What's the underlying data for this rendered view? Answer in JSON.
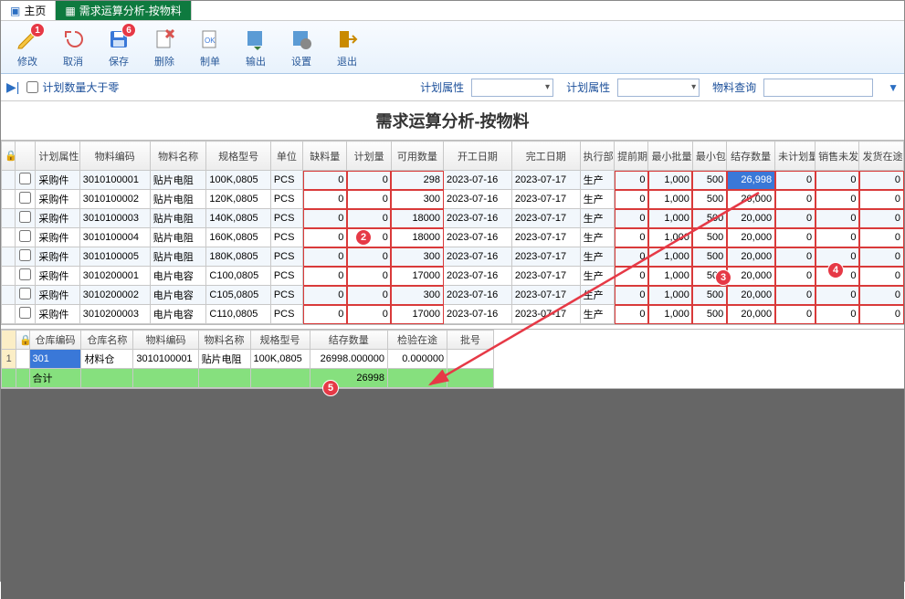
{
  "tabs": {
    "home": "主页",
    "current": "需求运算分析-按物料"
  },
  "toolbar": {
    "modify": "修改",
    "cancel": "取消",
    "save": "保存",
    "delete": "删除",
    "makeorder": "制单",
    "export": "输出",
    "settings": "设置",
    "exit": "退出",
    "badge_modify": "1",
    "badge_save": "6"
  },
  "filter": {
    "check_label": "计划数量大于零",
    "plan_attr1_label": "计划属性",
    "plan_attr2_label": "计划属性",
    "material_search_label": "物料查询"
  },
  "title": "需求运算分析-按物料",
  "headers": [
    "",
    "",
    "计划属性",
    "物料编码",
    "物料名称",
    "规格型号",
    "单位",
    "缺料量",
    "计划量",
    "可用数量",
    "开工日期",
    "完工日期",
    "执行部门",
    "提前期",
    "最小批量",
    "最小包装",
    "结存数量",
    "未计划量",
    "销售未发货量",
    "发货在途量"
  ],
  "rows": [
    {
      "pa": "采购件",
      "code": "3010100001",
      "name": "贴片电阻",
      "spec": "100K,0805",
      "uom": "PCS",
      "short": "0",
      "plan": "0",
      "avail": "298",
      "start": "2023-07-16",
      "end": "2023-07-17",
      "dept": "生产",
      "lead": "0",
      "minb": "1,000",
      "minp": "500",
      "stock": "26,998",
      "unplan": "0",
      "unsent": "0",
      "intransit": "0",
      "hlstock": true
    },
    {
      "pa": "采购件",
      "code": "3010100002",
      "name": "贴片电阻",
      "spec": "120K,0805",
      "uom": "PCS",
      "short": "0",
      "plan": "0",
      "avail": "300",
      "start": "2023-07-16",
      "end": "2023-07-17",
      "dept": "生产",
      "lead": "0",
      "minb": "1,000",
      "minp": "500",
      "stock": "20,000",
      "unplan": "0",
      "unsent": "0",
      "intransit": "0"
    },
    {
      "pa": "采购件",
      "code": "3010100003",
      "name": "贴片电阻",
      "spec": "140K,0805",
      "uom": "PCS",
      "short": "0",
      "plan": "0",
      "avail": "18000",
      "start": "2023-07-16",
      "end": "2023-07-17",
      "dept": "生产",
      "lead": "0",
      "minb": "1,000",
      "minp": "500",
      "stock": "20,000",
      "unplan": "0",
      "unsent": "0",
      "intransit": "0"
    },
    {
      "pa": "采购件",
      "code": "3010100004",
      "name": "贴片电阻",
      "spec": "160K,0805",
      "uom": "PCS",
      "short": "0",
      "plan": "0",
      "avail": "18000",
      "start": "2023-07-16",
      "end": "2023-07-17",
      "dept": "生产",
      "lead": "0",
      "minb": "1,000",
      "minp": "500",
      "stock": "20,000",
      "unplan": "0",
      "unsent": "0",
      "intransit": "0"
    },
    {
      "pa": "采购件",
      "code": "3010100005",
      "name": "贴片电阻",
      "spec": "180K,0805",
      "uom": "PCS",
      "short": "0",
      "plan": "0",
      "avail": "300",
      "start": "2023-07-16",
      "end": "2023-07-17",
      "dept": "生产",
      "lead": "0",
      "minb": "1,000",
      "minp": "500",
      "stock": "20,000",
      "unplan": "0",
      "unsent": "0",
      "intransit": "0"
    },
    {
      "pa": "采购件",
      "code": "3010200001",
      "name": "电片电容",
      "spec": "C100,0805",
      "uom": "PCS",
      "short": "0",
      "plan": "0",
      "avail": "17000",
      "start": "2023-07-16",
      "end": "2023-07-17",
      "dept": "生产",
      "lead": "0",
      "minb": "1,000",
      "minp": "500",
      "stock": "20,000",
      "unplan": "0",
      "unsent": "0",
      "intransit": "0"
    },
    {
      "pa": "采购件",
      "code": "3010200002",
      "name": "电片电容",
      "spec": "C105,0805",
      "uom": "PCS",
      "short": "0",
      "plan": "0",
      "avail": "300",
      "start": "2023-07-16",
      "end": "2023-07-17",
      "dept": "生产",
      "lead": "0",
      "minb": "1,000",
      "minp": "500",
      "stock": "20,000",
      "unplan": "0",
      "unsent": "0",
      "intransit": "0"
    },
    {
      "pa": "采购件",
      "code": "3010200003",
      "name": "电片电容",
      "spec": "C110,0805",
      "uom": "PCS",
      "short": "0",
      "plan": "0",
      "avail": "17000",
      "start": "2023-07-16",
      "end": "2023-07-17",
      "dept": "生产",
      "lead": "0",
      "minb": "1,000",
      "minp": "500",
      "stock": "20,000",
      "unplan": "0",
      "unsent": "0",
      "intransit": "0"
    }
  ],
  "headers2": [
    "",
    "",
    "仓库编码",
    "仓库名称",
    "物料编码",
    "物料名称",
    "规格型号",
    "结存数量",
    "检验在途",
    "批号"
  ],
  "rows2": [
    {
      "n": "1",
      "wc": "301",
      "wn": "材料仓",
      "mc": "3010100001",
      "mn": "贴片电阻",
      "spec": "100K,0805",
      "stock": "26998.000000",
      "insp": "0.000000",
      "lot": ""
    }
  ],
  "sum": {
    "label": "合计",
    "v": "26998"
  },
  "ann": {
    "a1": "1",
    "a2": "2",
    "a3": "3",
    "a4": "4",
    "a5": "5",
    "a6": "6"
  }
}
